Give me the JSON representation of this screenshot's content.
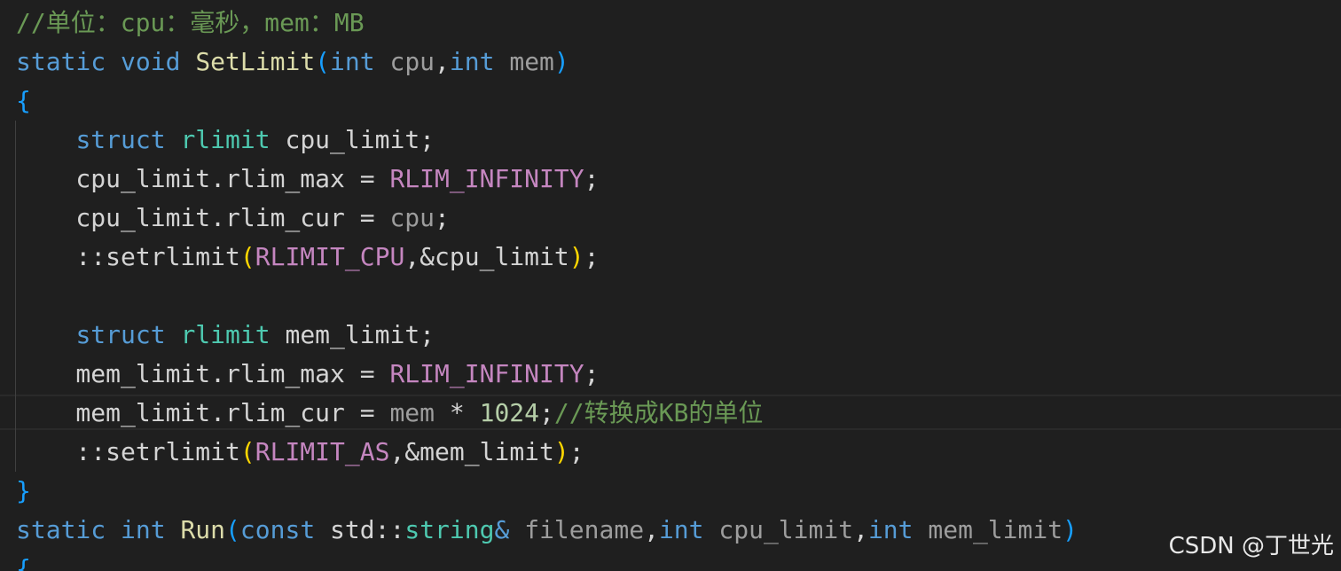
{
  "colors": {
    "background": "#1f1f1f",
    "default": "#d4d4d4",
    "keyword": "#569cd6",
    "type": "#4ec9b0",
    "function": "#dcdcaa",
    "param": "#9d9d9d",
    "macro": "#c586c0",
    "number": "#b5cea8",
    "comment": "#6a9955",
    "paren_blue": "#179fff",
    "paren_yellow": "#ffd700"
  },
  "code_lines": [
    [
      {
        "t": "//单位：cpu：毫秒，mem：MB",
        "c": "comment"
      }
    ],
    [
      {
        "t": "static",
        "c": "keyword"
      },
      {
        "t": " ",
        "c": "default"
      },
      {
        "t": "void",
        "c": "keyword"
      },
      {
        "t": " ",
        "c": "default"
      },
      {
        "t": "SetLimit",
        "c": "function"
      },
      {
        "t": "(",
        "c": "paren_blue"
      },
      {
        "t": "int",
        "c": "keyword"
      },
      {
        "t": " ",
        "c": "default"
      },
      {
        "t": "cpu",
        "c": "param"
      },
      {
        "t": ",",
        "c": "default"
      },
      {
        "t": "int",
        "c": "keyword"
      },
      {
        "t": " ",
        "c": "default"
      },
      {
        "t": "mem",
        "c": "param"
      },
      {
        "t": ")",
        "c": "paren_blue"
      }
    ],
    [
      {
        "t": "{",
        "c": "paren_blue"
      }
    ],
    [
      {
        "t": "    ",
        "c": "default"
      },
      {
        "t": "struct",
        "c": "keyword"
      },
      {
        "t": " ",
        "c": "default"
      },
      {
        "t": "rlimit",
        "c": "type"
      },
      {
        "t": " cpu_limit;",
        "c": "default"
      }
    ],
    [
      {
        "t": "    cpu_limit.rlim_max = ",
        "c": "default"
      },
      {
        "t": "RLIM_INFINITY",
        "c": "macro"
      },
      {
        "t": ";",
        "c": "default"
      }
    ],
    [
      {
        "t": "    cpu_limit.rlim_cur = ",
        "c": "default"
      },
      {
        "t": "cpu",
        "c": "param"
      },
      {
        "t": ";",
        "c": "default"
      }
    ],
    [
      {
        "t": "    ::setrlimit",
        "c": "default"
      },
      {
        "t": "(",
        "c": "paren_yellow"
      },
      {
        "t": "RLIMIT_CPU",
        "c": "macro"
      },
      {
        "t": ",&cpu_limit",
        "c": "default"
      },
      {
        "t": ")",
        "c": "paren_yellow"
      },
      {
        "t": ";",
        "c": "default"
      }
    ],
    [
      {
        "t": "",
        "c": "default"
      }
    ],
    [
      {
        "t": "    ",
        "c": "default"
      },
      {
        "t": "struct",
        "c": "keyword"
      },
      {
        "t": " ",
        "c": "default"
      },
      {
        "t": "rlimit",
        "c": "type"
      },
      {
        "t": " mem_limit;",
        "c": "default"
      }
    ],
    [
      {
        "t": "    mem_limit.rlim_max = ",
        "c": "default"
      },
      {
        "t": "RLIM_INFINITY",
        "c": "macro"
      },
      {
        "t": ";",
        "c": "default"
      }
    ],
    [
      {
        "t": "    mem_limit.rlim_cur = ",
        "c": "default"
      },
      {
        "t": "mem",
        "c": "param"
      },
      {
        "t": " * ",
        "c": "default"
      },
      {
        "t": "1024",
        "c": "number"
      },
      {
        "t": ";",
        "c": "default"
      },
      {
        "t": "//转换成KB的单位",
        "c": "comment"
      }
    ],
    [
      {
        "t": "    ::setrlimit",
        "c": "default"
      },
      {
        "t": "(",
        "c": "paren_yellow"
      },
      {
        "t": "RLIMIT_AS",
        "c": "macro"
      },
      {
        "t": ",&mem_limit",
        "c": "default"
      },
      {
        "t": ")",
        "c": "paren_yellow"
      },
      {
        "t": ";",
        "c": "default"
      }
    ],
    [
      {
        "t": "}",
        "c": "paren_blue"
      }
    ],
    [
      {
        "t": "static",
        "c": "keyword"
      },
      {
        "t": " ",
        "c": "default"
      },
      {
        "t": "int",
        "c": "keyword"
      },
      {
        "t": " ",
        "c": "default"
      },
      {
        "t": "Run",
        "c": "function"
      },
      {
        "t": "(",
        "c": "paren_blue"
      },
      {
        "t": "const",
        "c": "keyword"
      },
      {
        "t": " std::",
        "c": "default"
      },
      {
        "t": "string",
        "c": "type"
      },
      {
        "t": "&",
        "c": "keyword"
      },
      {
        "t": " ",
        "c": "default"
      },
      {
        "t": "filename",
        "c": "param"
      },
      {
        "t": ",",
        "c": "default"
      },
      {
        "t": "int",
        "c": "keyword"
      },
      {
        "t": " ",
        "c": "default"
      },
      {
        "t": "cpu_limit",
        "c": "param"
      },
      {
        "t": ",",
        "c": "default"
      },
      {
        "t": "int",
        "c": "keyword"
      },
      {
        "t": " ",
        "c": "default"
      },
      {
        "t": "mem_limit",
        "c": "param"
      },
      {
        "t": ")",
        "c": "paren_blue"
      }
    ],
    [
      {
        "t": "{",
        "c": "paren_blue"
      }
    ]
  ],
  "watermark": "CSDN @丁世光"
}
